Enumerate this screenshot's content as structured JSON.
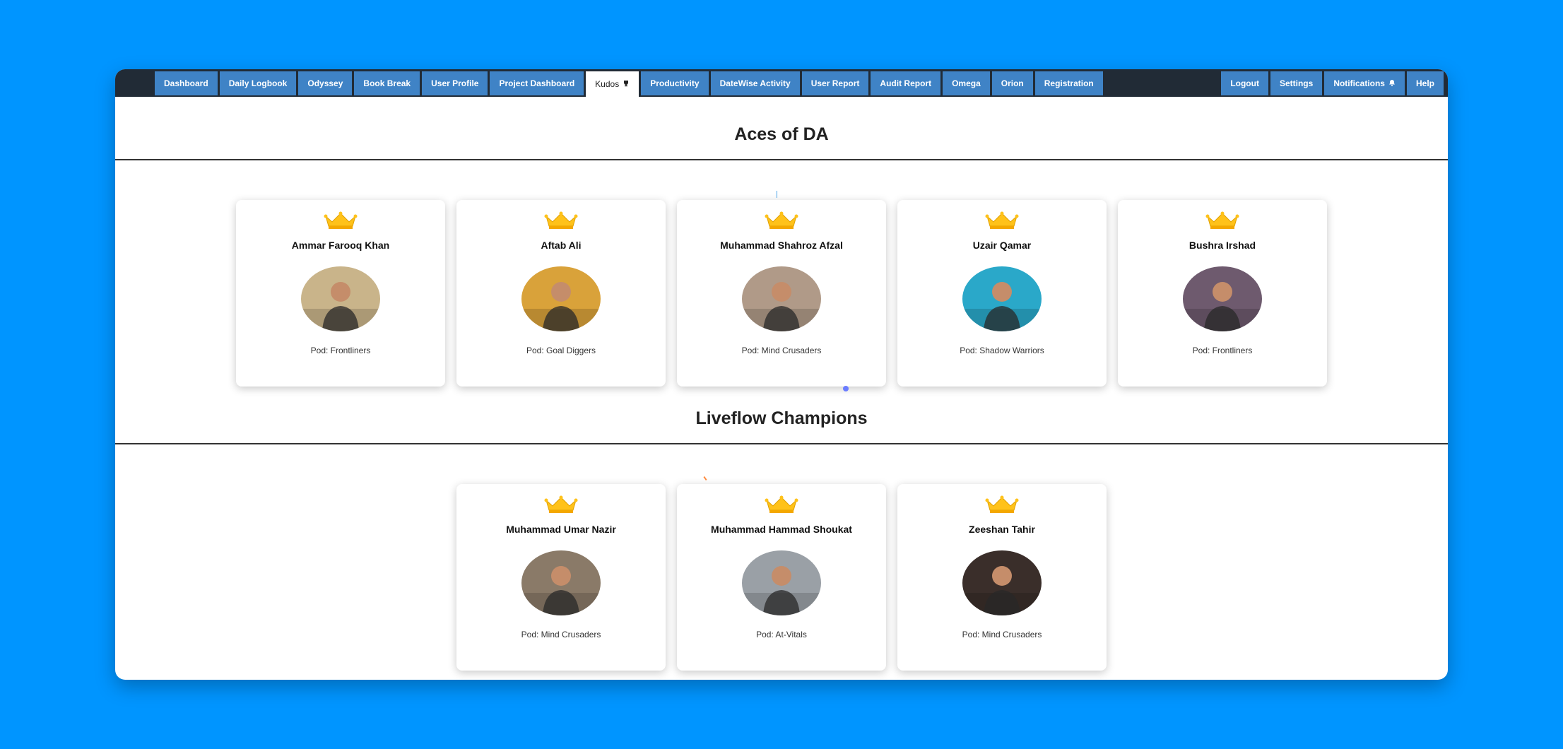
{
  "nav": {
    "left_tabs": [
      {
        "label": "Dashboard"
      },
      {
        "label": "Daily Logbook"
      },
      {
        "label": "Odyssey"
      },
      {
        "label": "Book Break"
      },
      {
        "label": "User Profile"
      },
      {
        "label": "Project Dashboard"
      },
      {
        "label": "Kudos",
        "icon": "trophy-icon",
        "active": true
      },
      {
        "label": "Productivity"
      },
      {
        "label": "DateWise Activity"
      },
      {
        "label": "User Report"
      },
      {
        "label": "Audit Report"
      },
      {
        "label": "Omega"
      },
      {
        "label": "Orion"
      },
      {
        "label": "Registration"
      }
    ],
    "right_tabs": [
      {
        "label": "Logout"
      },
      {
        "label": "Settings"
      },
      {
        "label": "Notifications",
        "icon": "bell-icon"
      },
      {
        "label": "Help"
      }
    ]
  },
  "sections": [
    {
      "title": "Aces of DA",
      "cards": [
        {
          "name": "Ammar Farooq Khan",
          "pod": "Pod: Frontliners",
          "photo_tone": "#c9b48a"
        },
        {
          "name": "Aftab Ali",
          "pod": "Pod: Goal Diggers",
          "photo_tone": "#d9a23a"
        },
        {
          "name": "Muhammad Shahroz Afzal",
          "pod": "Pod: Mind Crusaders",
          "photo_tone": "#b09a88"
        },
        {
          "name": "Uzair Qamar",
          "pod": "Pod: Shadow Warriors",
          "photo_tone": "#2aa8c9"
        },
        {
          "name": "Bushra Irshad",
          "pod": "Pod: Frontliners",
          "photo_tone": "#6e5a6e"
        }
      ]
    },
    {
      "title": "Liveflow Champions",
      "cards": [
        {
          "name": "Muhammad Umar Nazir",
          "pod": "Pod: Mind Crusaders",
          "photo_tone": "#8a7a68"
        },
        {
          "name": "Muhammad Hammad Shoukat",
          "pod": "Pod: At-Vitals",
          "photo_tone": "#9aa0a6"
        },
        {
          "name": "Zeeshan Tahir",
          "pod": "Pod: Mind Crusaders",
          "photo_tone": "#3a2e2a"
        }
      ]
    }
  ],
  "colors": {
    "background": "#0095ff",
    "navbar": "#212b36",
    "tab": "#3f83c6",
    "crown": "#ffc21a"
  }
}
